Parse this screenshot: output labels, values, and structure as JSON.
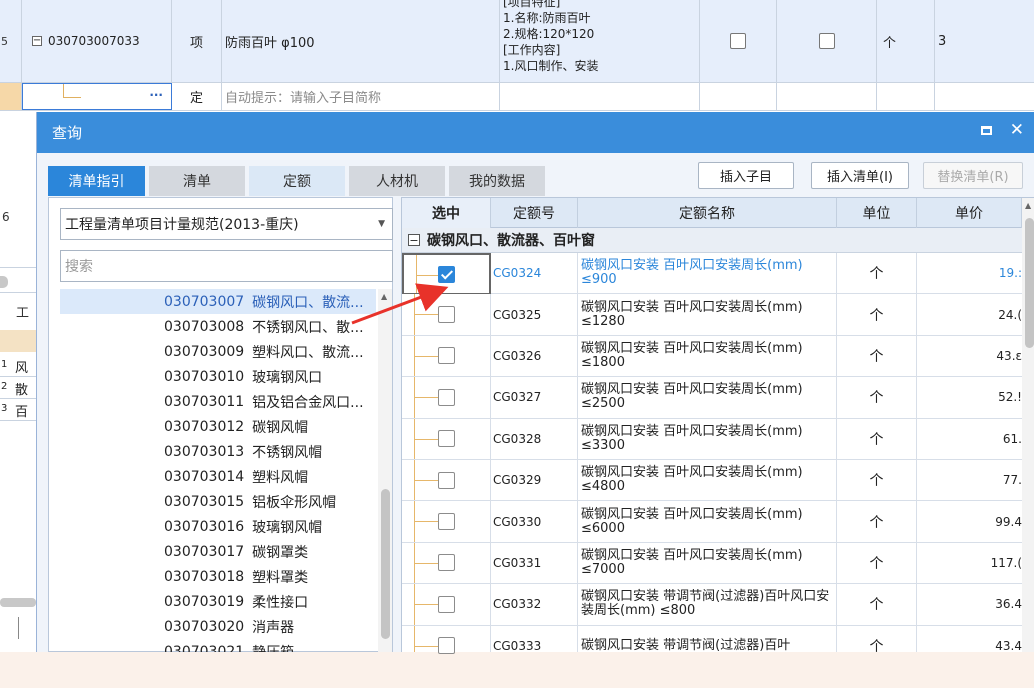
{
  "bg_sheet": {
    "row_a": {
      "row_no": "5",
      "code": "030703007033",
      "type": "项",
      "name": "防雨百叶 φ100",
      "features": [
        "[项目特征]",
        "1.名称:防雨百叶",
        "2.规格:120*120",
        "[工作内容]",
        "1.风口制作、安装"
      ],
      "unit": "个",
      "qty": "3"
    },
    "row_b": {
      "ellipsis": "···",
      "type": "定",
      "name_placeholder": "自动提示：请输入子目简称"
    },
    "left_fragments": {
      "row_no": "6",
      "header_char": "工",
      "rows": [
        {
          "no": "1",
          "text": "风"
        },
        {
          "no": "2",
          "text": "散"
        },
        {
          "no": "3",
          "text": "百"
        }
      ]
    }
  },
  "dialog": {
    "title": "查询",
    "tabs": [
      "清单指引",
      "清单",
      "定额",
      "人材机",
      "我的数据"
    ],
    "buttons": {
      "insert_sub": "插入子目",
      "insert_list": "插入清单(I)",
      "replace_list": "替换清单(R)"
    },
    "left": {
      "selected_spec": "工程量清单项目计量规范(2013-重庆)",
      "search_placeholder": "搜索",
      "items": [
        {
          "code": "030703007",
          "name": "碳钢风口、散流..."
        },
        {
          "code": "030703008",
          "name": "不锈钢风口、散..."
        },
        {
          "code": "030703009",
          "name": "塑料风口、散流..."
        },
        {
          "code": "030703010",
          "name": "玻璃钢风口"
        },
        {
          "code": "030703011",
          "name": "铝及铝合金风口..."
        },
        {
          "code": "030703012",
          "name": "碳钢风帽"
        },
        {
          "code": "030703013",
          "name": "不锈钢风帽"
        },
        {
          "code": "030703014",
          "name": "塑料风帽"
        },
        {
          "code": "030703015",
          "name": "铝板伞形风帽"
        },
        {
          "code": "030703016",
          "name": "玻璃钢风帽"
        },
        {
          "code": "030703017",
          "name": "碳钢罩类"
        },
        {
          "code": "030703018",
          "name": "塑料罩类"
        },
        {
          "code": "030703019",
          "name": "柔性接口"
        },
        {
          "code": "030703020",
          "name": "消声器"
        },
        {
          "code": "030703021",
          "name": "静压箱"
        }
      ]
    },
    "grid": {
      "headers": [
        "选中",
        "定额号",
        "定额名称",
        "单位",
        "单价"
      ],
      "group_title": "碳钢风口、散流器、百叶窗",
      "rows": [
        {
          "checked": true,
          "code": "CG0324",
          "name": "碳钢风口安装 百叶风口安装周长(mm) ≤900",
          "unit": "个",
          "price": "19.:"
        },
        {
          "checked": false,
          "code": "CG0325",
          "name": "碳钢风口安装 百叶风口安装周长(mm) ≤1280",
          "unit": "个",
          "price": "24.("
        },
        {
          "checked": false,
          "code": "CG0326",
          "name": "碳钢风口安装 百叶风口安装周长(mm) ≤1800",
          "unit": "个",
          "price": "43.ε"
        },
        {
          "checked": false,
          "code": "CG0327",
          "name": "碳钢风口安装 百叶风口安装周长(mm) ≤2500",
          "unit": "个",
          "price": "52.!"
        },
        {
          "checked": false,
          "code": "CG0328",
          "name": "碳钢风口安装 百叶风口安装周长(mm) ≤3300",
          "unit": "个",
          "price": "61."
        },
        {
          "checked": false,
          "code": "CG0329",
          "name": "碳钢风口安装 百叶风口安装周长(mm) ≤4800",
          "unit": "个",
          "price": "77."
        },
        {
          "checked": false,
          "code": "CG0330",
          "name": "碳钢风口安装 百叶风口安装周长(mm) ≤6000",
          "unit": "个",
          "price": "99.4"
        },
        {
          "checked": false,
          "code": "CG0331",
          "name": "碳钢风口安装 百叶风口安装周长(mm) ≤7000",
          "unit": "个",
          "price": "117.("
        },
        {
          "checked": false,
          "code": "CG0332",
          "name": "碳钢风口安装 带调节阀(过滤器)百叶风口安装周长(mm) ≤800",
          "unit": "个",
          "price": "36.4"
        },
        {
          "checked": false,
          "code": "CG0333",
          "name": "碳钢风口安装 带调节阀(过滤器)百叶",
          "unit": "个",
          "price": "43.4"
        }
      ]
    }
  },
  "colors": {
    "title_bar": "#3a8ddb",
    "active_tab": "#2b86da",
    "selected_text": "#2b86da",
    "annotation_arrow": "#e8322a"
  }
}
